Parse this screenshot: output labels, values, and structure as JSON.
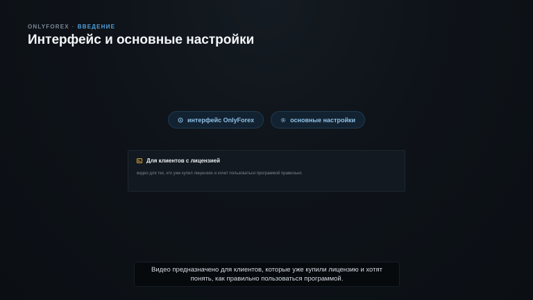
{
  "breadcrumb": {
    "brand": "ONLYFOREX",
    "separator": "·",
    "section": "ВВЕДЕНИЕ"
  },
  "page": {
    "title": "Интерфейс и основные настройки"
  },
  "tabs": [
    {
      "label": "интерфейс OnlyForex",
      "icon": "circle-icon"
    },
    {
      "label": "основные настройки",
      "icon": "gear-icon"
    }
  ],
  "card": {
    "icon": "license-card-icon",
    "title": "Для клиентов с лицензией",
    "description": "видео для тех, кто уже купил лицензию и хочет пользоваться программой правильно"
  },
  "subtitle": {
    "line1": "Видео предназначено для клиентов, которые уже купили лицензию и хотят",
    "line2": "понять, как правильно пользоваться программой."
  },
  "colors": {
    "accent": "#4fa3e0",
    "background": "#0e1319",
    "tab_bg": "#122231",
    "license_icon": "#d9a634"
  }
}
